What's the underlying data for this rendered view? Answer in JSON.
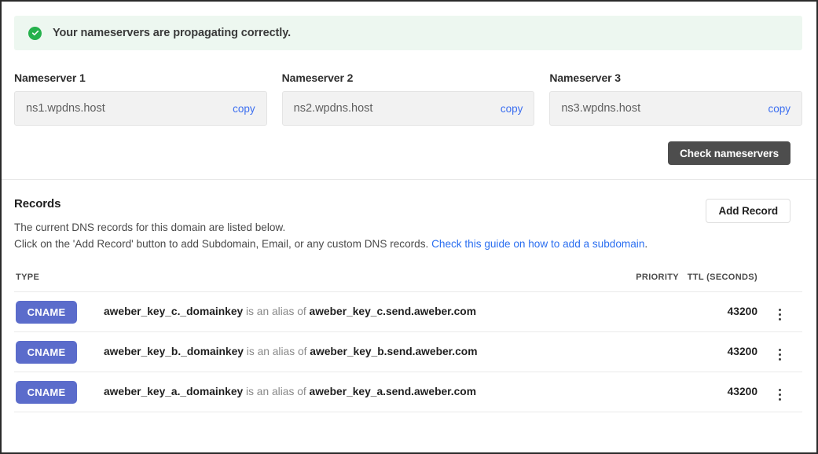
{
  "banner": {
    "icon": "check-circle-icon",
    "message": "Your nameservers are propagating correctly.",
    "background_color": "#edf7f0",
    "icon_color": "#25b14c"
  },
  "nameservers": {
    "copy_label": "copy",
    "items": [
      {
        "label": "Nameserver 1",
        "value": "ns1.wpdns.host"
      },
      {
        "label": "Nameserver 2",
        "value": "ns2.wpdns.host"
      },
      {
        "label": "Nameserver 3",
        "value": "ns3.wpdns.host"
      }
    ],
    "check_button": "Check nameservers",
    "check_button_color": "#4d4d4d"
  },
  "records": {
    "title": "Records",
    "description_line1": "The current DNS records for this domain are listed below.",
    "description_line2_prefix": "Click on the 'Add Record' button to add Subdomain, Email, or any custom DNS records. ",
    "description_link": "Check this guide on how to add a subdomain",
    "description_line2_suffix": ".",
    "add_button": "Add Record",
    "link_color": "#2a6ef0",
    "columns": {
      "type": "TYPE",
      "detail": "",
      "priority": "PRIORITY",
      "ttl": "TTL (SECONDS)",
      "menu": ""
    },
    "badge_color": "#5b6ccb",
    "rows": [
      {
        "type": "CNAME",
        "name": "aweber_key_c._domainkey",
        "relation": " is an alias of ",
        "target": "aweber_key_c.send.aweber.com",
        "priority": "",
        "ttl": "43200",
        "menu_icon": "kebab-menu-icon"
      },
      {
        "type": "CNAME",
        "name": "aweber_key_b._domainkey",
        "relation": " is an alias of ",
        "target": "aweber_key_b.send.aweber.com",
        "priority": "",
        "ttl": "43200",
        "menu_icon": "kebab-menu-icon"
      },
      {
        "type": "CNAME",
        "name": "aweber_key_a._domainkey",
        "relation": " is an alias of ",
        "target": "aweber_key_a.send.aweber.com",
        "priority": "",
        "ttl": "43200",
        "menu_icon": "kebab-menu-icon"
      }
    ]
  }
}
